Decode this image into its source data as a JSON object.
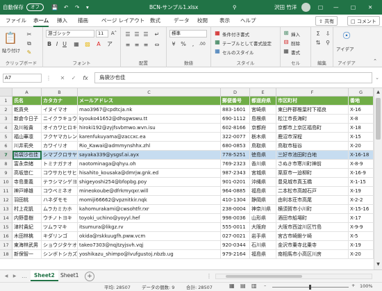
{
  "titlebar": {
    "autosave_label": "自動保存",
    "autosave_state": "オフ",
    "filename": "BCN-サンプル1.xlsx",
    "user": "沢田 竹洋",
    "colors": {
      "brand": "#217346"
    }
  },
  "tabs": [
    "ファイル",
    "ホーム",
    "挿入",
    "描画",
    "ページ レイアウト",
    "数式",
    "データ",
    "校閲",
    "表示",
    "ヘルプ"
  ],
  "tab_selected": "ホーム",
  "share_label": "共有",
  "comment_label": "コメント",
  "ribbon": {
    "clipboard": {
      "paste": "貼り付け",
      "label": "クリップボード"
    },
    "font": {
      "name": "游ゴシック",
      "size": "11",
      "label": "フォント"
    },
    "alignment": {
      "label": "配置"
    },
    "number": {
      "format": "標準",
      "label": "数値"
    },
    "styles": {
      "conditional": "条件付き書式",
      "table": "テーブルとして書式設定",
      "cell": "セルのスタイル",
      "label": "スタイル"
    },
    "cells": {
      "insert": "挿入",
      "delete": "削除",
      "format": "書式",
      "label": "セル"
    },
    "editing": {
      "label": "編集"
    },
    "ideas": {
      "button": "アイデア",
      "label": "アイデア"
    }
  },
  "formula": {
    "namebox": "A7",
    "fx": "fx",
    "content": "烏袋沙也佳"
  },
  "grid": {
    "columns": [
      "A",
      "B",
      "C",
      "D",
      "E",
      "F",
      "G"
    ],
    "header": [
      "氏名",
      "カタカナ",
      "メールアドレス",
      "郵便番号",
      "都道府県",
      "市区町村",
      "番地"
    ],
    "rows": [
      {
        "n": "2",
        "cells": [
          "乾貢央",
          "イヌイマオ",
          "mao3967@cpdtcja.nk",
          "883-1601",
          "宮崎県",
          "東臼杵郡椎葉村下福良",
          "X-16"
        ]
      },
      {
        "n": "3",
        "cells": [
          "新倉今日子",
          "ニイクラキョウコ",
          "kyouko41652@dhsgwswu.tt",
          "690-1112",
          "島根県",
          "松江市長海町",
          "X-8"
        ]
      },
      {
        "n": "4",
        "cells": [
          "及川裕貴",
          "オイカワヒロキ",
          "hiroki192@zyjfsvbmwo.wvn.isu",
          "602-8166",
          "京都府",
          "京都市上京区福島町",
          "X-18"
        ]
      },
      {
        "n": "5",
        "cells": [
          "福山華凛",
          "フクヤマカレン",
          "karenfukuyama@zaccxc.ea",
          "322-0077",
          "栃木県",
          "鹿沼市深程",
          "X-15"
        ]
      },
      {
        "n": "6",
        "cells": [
          "川井莉央",
          "カワイリオ",
          "Rio_Kawai@admmynshhx.zhl",
          "680-0853",
          "鳥取県",
          "鳥取市桜谷",
          "X-20"
        ]
      },
      {
        "n": "7",
        "cells": [
          "烏袋沙也佳",
          "シマブクロサヤカ",
          "sayaka339@ysgsf.ai.ayx",
          "778-5251",
          "徳島県",
          "三好市池田町白地",
          "X-16-18"
        ]
      },
      {
        "n": "8",
        "cells": [
          "富永奈緒",
          "トミナガナオ",
          "naotominaga@qhyu.oh",
          "769-2323",
          "香川県",
          "さぬき市寒川町神前",
          "X-8-9"
        ]
      },
      {
        "n": "9",
        "cells": [
          "高坂悠仁",
          "コウサカヒサヒト",
          "hisahito_kousaka@dmrjw.gnk.ed",
          "987-2343",
          "宮城県",
          "栗原市一迫柳町",
          "X-16-9"
        ]
      },
      {
        "n": "10",
        "cells": [
          "寺島重義",
          "テラシマシゲヨシ",
          "shigeyoshi254@bfopbg.poy",
          "901-0201",
          "沖縄県",
          "豊見城市真玉橋",
          "X-1-15"
        ]
      },
      {
        "n": "11",
        "cells": [
          "神戸峰雄",
          "コウベミネオ",
          "mineokoube@dfrkmyqxr.will",
          "964-0885",
          "福島県",
          "二本松市高越石戸",
          "X-19"
        ]
      },
      {
        "n": "12",
        "cells": [
          "羽田桃",
          "ハネダモモ",
          "momiji66662@vpznitkir.nqk",
          "410-1304",
          "静岡県",
          "由利本荘市高尾",
          "X-2-2"
        ]
      },
      {
        "n": "13",
        "cells": [
          "村上花凱",
          "ムラカミカホ",
          "kahomurakami@cwsohtfr.rxr",
          "238-0004",
          "神奈川県",
          "横須賀市小川町",
          "X-15-16"
        ]
      },
      {
        "n": "14",
        "cells": [
          "内野豊樹",
          "ウチノトヨキ",
          "toyoki_uchino@yoyyl.hef",
          "998-0036",
          "山形県",
          "酒田市船場町",
          "X-17"
        ]
      },
      {
        "n": "15",
        "cells": [
          "津村貴紀",
          "ツムラマキ",
          "itsumura@likgz.rv",
          "555-0011",
          "大阪府",
          "大阪市西淀川区竹島",
          "X-9-9"
        ]
      },
      {
        "n": "16",
        "cells": [
          "木田林檎",
          "キダリンゴ",
          "okida@rskkuugfh.pww.vcm",
          "027-0021",
          "岩手県",
          "宮古市崎鍬ケ崎",
          "X-5"
        ]
      },
      {
        "n": "17",
        "cells": [
          "東海林武男",
          "ショウジタケオ",
          "takeo7303@nqjtzyjsvh.vqj",
          "920-0344",
          "石川県",
          "金沢市乗寺北乗寺",
          "X-19"
        ]
      },
      {
        "n": "18",
        "cells": [
          "新保智一",
          "シンボトシカズ",
          "yoshikazu_shimpo@lvufgustoj.nbzb.ug",
          "979-2164",
          "福島県",
          "南相馬市小高区川房",
          "X-20"
        ]
      }
    ],
    "selected_row": "7"
  },
  "sheets": [
    "Sheet2",
    "Sheet1"
  ],
  "active_sheet": "Sheet2",
  "status": {
    "average": "平均: 28507",
    "count": "データの個数: 9",
    "sum": "合計: 28507",
    "zoom": "100%"
  }
}
